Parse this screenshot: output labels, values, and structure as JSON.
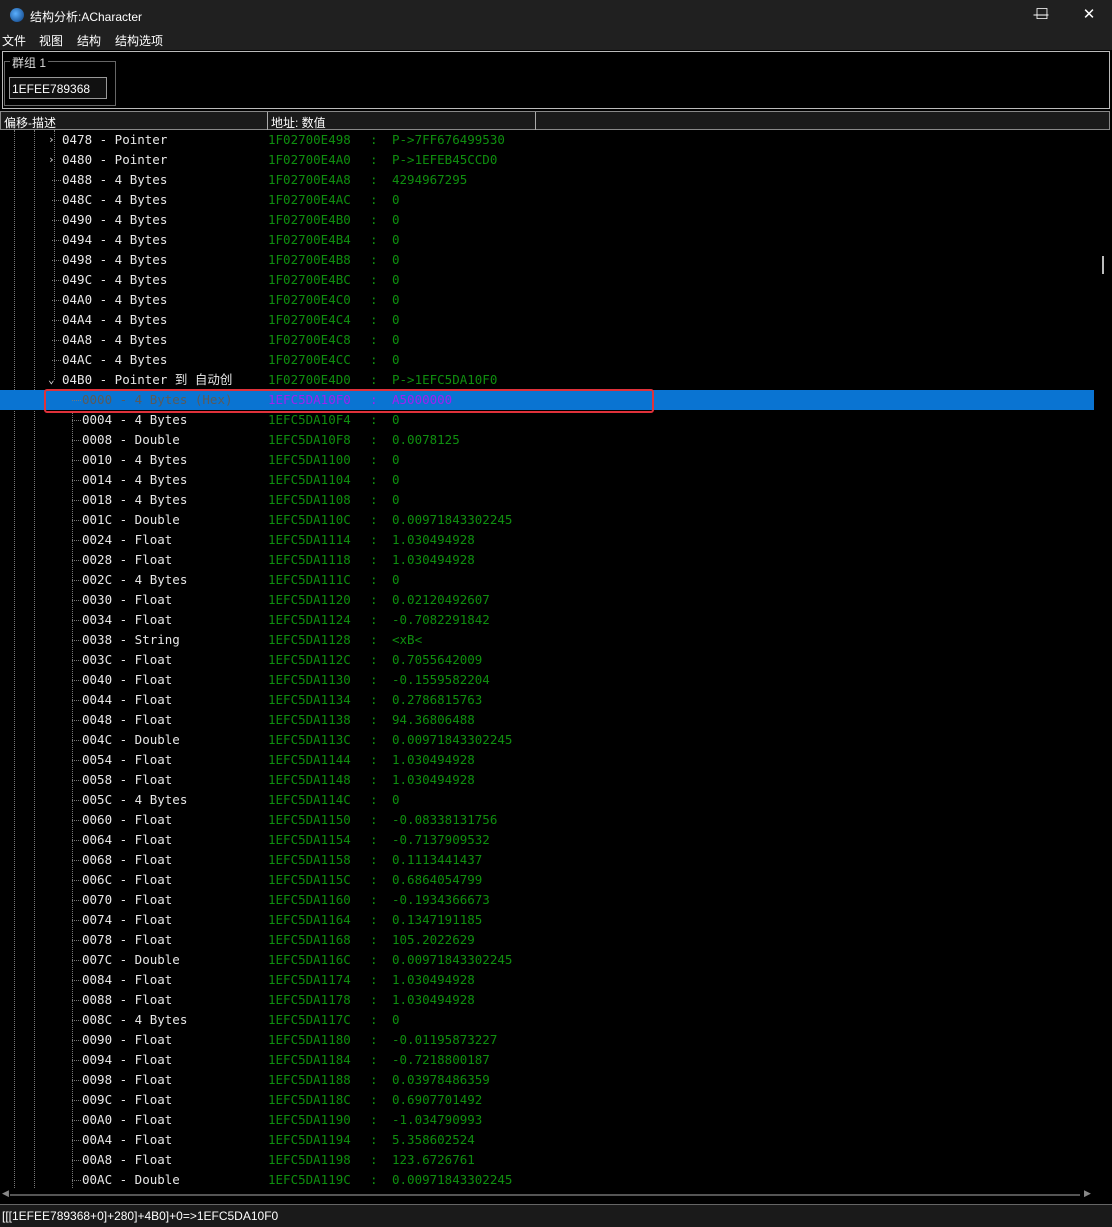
{
  "window": {
    "title": "结构分析:ACharacter",
    "minimize": "—",
    "maximize": "☐",
    "close": "✕"
  },
  "menu": [
    "文件",
    "视图",
    "结构",
    "结构选项"
  ],
  "group": {
    "label": "群组 1",
    "address": "1EFEE789368"
  },
  "columns": {
    "desc": "偏移-描述",
    "addr": "地址: 数值"
  },
  "rows": [
    {
      "desc": "0478 - Pointer",
      "addr": "1F02700E498",
      "val": "P->7FF676499530",
      "lvl": 1,
      "exp": "closed"
    },
    {
      "desc": "0480 - Pointer",
      "addr": "1F02700E4A0",
      "val": "P->1EFEB45CCD0",
      "lvl": 1,
      "exp": "closed"
    },
    {
      "desc": "0488 - 4 Bytes",
      "addr": "1F02700E4A8",
      "val": "4294967295",
      "lvl": 1
    },
    {
      "desc": "048C - 4 Bytes",
      "addr": "1F02700E4AC",
      "val": "0",
      "lvl": 1
    },
    {
      "desc": "0490 - 4 Bytes",
      "addr": "1F02700E4B0",
      "val": "0",
      "lvl": 1
    },
    {
      "desc": "0494 - 4 Bytes",
      "addr": "1F02700E4B4",
      "val": "0",
      "lvl": 1
    },
    {
      "desc": "0498 - 4 Bytes",
      "addr": "1F02700E4B8",
      "val": "0",
      "lvl": 1
    },
    {
      "desc": "049C - 4 Bytes",
      "addr": "1F02700E4BC",
      "val": "0",
      "lvl": 1
    },
    {
      "desc": "04A0 - 4 Bytes",
      "addr": "1F02700E4C0",
      "val": "0",
      "lvl": 1
    },
    {
      "desc": "04A4 - 4 Bytes",
      "addr": "1F02700E4C4",
      "val": "0",
      "lvl": 1
    },
    {
      "desc": "04A8 - 4 Bytes",
      "addr": "1F02700E4C8",
      "val": "0",
      "lvl": 1
    },
    {
      "desc": "04AC - 4 Bytes",
      "addr": "1F02700E4CC",
      "val": "0",
      "lvl": 1
    },
    {
      "desc": "04B0 - Pointer 到 自动创",
      "addr": "1F02700E4D0",
      "val": "P->1EFC5DA10F0",
      "lvl": 1,
      "exp": "open"
    },
    {
      "desc": "0000 - 4 Bytes (Hex)",
      "addr": "1EFC5DA10F0",
      "val": "A5000000",
      "lvl": 2,
      "sel": true
    },
    {
      "desc": "0004 - 4 Bytes",
      "addr": "1EFC5DA10F4",
      "val": "0",
      "lvl": 2
    },
    {
      "desc": "0008 - Double",
      "addr": "1EFC5DA10F8",
      "val": "0.0078125",
      "lvl": 2
    },
    {
      "desc": "0010 - 4 Bytes",
      "addr": "1EFC5DA1100",
      "val": "0",
      "lvl": 2
    },
    {
      "desc": "0014 - 4 Bytes",
      "addr": "1EFC5DA1104",
      "val": "0",
      "lvl": 2
    },
    {
      "desc": "0018 - 4 Bytes",
      "addr": "1EFC5DA1108",
      "val": "0",
      "lvl": 2
    },
    {
      "desc": "001C - Double",
      "addr": "1EFC5DA110C",
      "val": "0.00971843302245",
      "lvl": 2
    },
    {
      "desc": "0024 - Float",
      "addr": "1EFC5DA1114",
      "val": "1.030494928",
      "lvl": 2
    },
    {
      "desc": "0028 - Float",
      "addr": "1EFC5DA1118",
      "val": "1.030494928",
      "lvl": 2
    },
    {
      "desc": "002C - 4 Bytes",
      "addr": "1EFC5DA111C",
      "val": "0",
      "lvl": 2
    },
    {
      "desc": "0030 - Float",
      "addr": "1EFC5DA1120",
      "val": "0.02120492607",
      "lvl": 2
    },
    {
      "desc": "0034 - Float",
      "addr": "1EFC5DA1124",
      "val": "-0.7082291842",
      "lvl": 2
    },
    {
      "desc": "0038 - String",
      "addr": "1EFC5DA1128",
      "val": "<xB<",
      "lvl": 2
    },
    {
      "desc": "003C - Float",
      "addr": "1EFC5DA112C",
      "val": "0.7055642009",
      "lvl": 2
    },
    {
      "desc": "0040 - Float",
      "addr": "1EFC5DA1130",
      "val": "-0.1559582204",
      "lvl": 2
    },
    {
      "desc": "0044 - Float",
      "addr": "1EFC5DA1134",
      "val": "0.2786815763",
      "lvl": 2
    },
    {
      "desc": "0048 - Float",
      "addr": "1EFC5DA1138",
      "val": "94.36806488",
      "lvl": 2
    },
    {
      "desc": "004C - Double",
      "addr": "1EFC5DA113C",
      "val": "0.00971843302245",
      "lvl": 2
    },
    {
      "desc": "0054 - Float",
      "addr": "1EFC5DA1144",
      "val": "1.030494928",
      "lvl": 2
    },
    {
      "desc": "0058 - Float",
      "addr": "1EFC5DA1148",
      "val": "1.030494928",
      "lvl": 2
    },
    {
      "desc": "005C - 4 Bytes",
      "addr": "1EFC5DA114C",
      "val": "0",
      "lvl": 2
    },
    {
      "desc": "0060 - Float",
      "addr": "1EFC5DA1150",
      "val": "-0.08338131756",
      "lvl": 2
    },
    {
      "desc": "0064 - Float",
      "addr": "1EFC5DA1154",
      "val": "-0.7137909532",
      "lvl": 2
    },
    {
      "desc": "0068 - Float",
      "addr": "1EFC5DA1158",
      "val": "0.1113441437",
      "lvl": 2
    },
    {
      "desc": "006C - Float",
      "addr": "1EFC5DA115C",
      "val": "0.6864054799",
      "lvl": 2
    },
    {
      "desc": "0070 - Float",
      "addr": "1EFC5DA1160",
      "val": "-0.1934366673",
      "lvl": 2
    },
    {
      "desc": "0074 - Float",
      "addr": "1EFC5DA1164",
      "val": "0.1347191185",
      "lvl": 2
    },
    {
      "desc": "0078 - Float",
      "addr": "1EFC5DA1168",
      "val": "105.2022629",
      "lvl": 2
    },
    {
      "desc": "007C - Double",
      "addr": "1EFC5DA116C",
      "val": "0.00971843302245",
      "lvl": 2
    },
    {
      "desc": "0084 - Float",
      "addr": "1EFC5DA1174",
      "val": "1.030494928",
      "lvl": 2
    },
    {
      "desc": "0088 - Float",
      "addr": "1EFC5DA1178",
      "val": "1.030494928",
      "lvl": 2
    },
    {
      "desc": "008C - 4 Bytes",
      "addr": "1EFC5DA117C",
      "val": "0",
      "lvl": 2
    },
    {
      "desc": "0090 - Float",
      "addr": "1EFC5DA1180",
      "val": "-0.01195873227",
      "lvl": 2
    },
    {
      "desc": "0094 - Float",
      "addr": "1EFC5DA1184",
      "val": "-0.7218800187",
      "lvl": 2
    },
    {
      "desc": "0098 - Float",
      "addr": "1EFC5DA1188",
      "val": "0.03978486359",
      "lvl": 2
    },
    {
      "desc": "009C - Float",
      "addr": "1EFC5DA118C",
      "val": "0.6907701492",
      "lvl": 2
    },
    {
      "desc": "00A0 - Float",
      "addr": "1EFC5DA1190",
      "val": "-1.034790993",
      "lvl": 2
    },
    {
      "desc": "00A4 - Float",
      "addr": "1EFC5DA1194",
      "val": "5.358602524",
      "lvl": 2
    },
    {
      "desc": "00A8 - Float",
      "addr": "1EFC5DA1198",
      "val": "123.6726761",
      "lvl": 2
    },
    {
      "desc": "00AC - Double",
      "addr": "1EFC5DA119C",
      "val": "0.00971843302245",
      "lvl": 2
    }
  ],
  "status": "[[[1EFEE789368+0]+280]+4B0]+0=>1EFC5DA10F0"
}
